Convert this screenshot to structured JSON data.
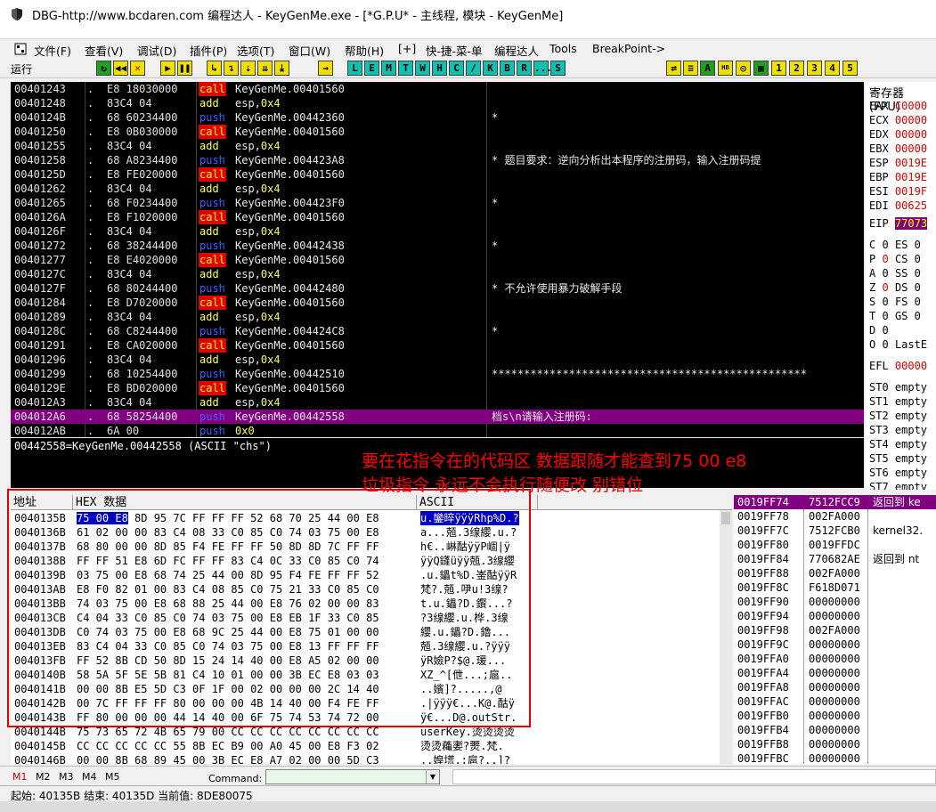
{
  "window": {
    "title": "DBG-http://www.bcdaren.com 编程达人 - KeyGenMe.exe - [*G.P.U* - 主线程, 模块 - KeyGenMe]"
  },
  "menu": [
    "文件(F)",
    "查看(V)",
    "调试(D)",
    "插件(P)",
    "选项(T)",
    "窗口(W)",
    "帮助(H)",
    "[+]",
    "快-捷-菜-单",
    "编程达人",
    "Tools",
    "BreakPoint->"
  ],
  "toolbar": {
    "status": "运行",
    "letters": [
      "L",
      "E",
      "M",
      "T",
      "W",
      "H",
      "C",
      "/",
      "K",
      "B",
      "R",
      "...",
      "S"
    ],
    "numbers": [
      "1",
      "2",
      "3",
      "4",
      "5"
    ]
  },
  "disasm": [
    {
      "addr": "00401243",
      "mark": ".",
      "hex": "E8 18030000",
      "mn": "call",
      "op": "KeyGenMe.00401560",
      "cm": ""
    },
    {
      "addr": "00401248",
      "mark": ".",
      "hex": "83C4 04",
      "mn": "add",
      "op": "esp,",
      "imm": "0x4",
      "cm": ""
    },
    {
      "addr": "0040124B",
      "mark": ".",
      "hex": "68 60234400",
      "mn": "push",
      "op": "KeyGenMe.00442360",
      "cm": "*"
    },
    {
      "addr": "00401250",
      "mark": ".",
      "hex": "E8 0B030000",
      "mn": "call",
      "op": "KeyGenMe.00401560",
      "cm": ""
    },
    {
      "addr": "00401255",
      "mark": ".",
      "hex": "83C4 04",
      "mn": "add",
      "op": "esp,",
      "imm": "0x4",
      "cm": ""
    },
    {
      "addr": "00401258",
      "mark": ".",
      "hex": "68 A8234400",
      "mn": "push",
      "op": "KeyGenMe.004423A8",
      "cm": "*  题目要求：逆向分析出本程序的注册码，输入注册码提"
    },
    {
      "addr": "0040125D",
      "mark": ".",
      "hex": "E8 FE020000",
      "mn": "call",
      "op": "KeyGenMe.00401560",
      "cm": ""
    },
    {
      "addr": "00401262",
      "mark": ".",
      "hex": "83C4 04",
      "mn": "add",
      "op": "esp,",
      "imm": "0x4",
      "cm": ""
    },
    {
      "addr": "00401265",
      "mark": ".",
      "hex": "68 F0234400",
      "mn": "push",
      "op": "KeyGenMe.004423F0",
      "cm": "*"
    },
    {
      "addr": "0040126A",
      "mark": ".",
      "hex": "E8 F1020000",
      "mn": "call",
      "op": "KeyGenMe.00401560",
      "cm": ""
    },
    {
      "addr": "0040126F",
      "mark": ".",
      "hex": "83C4 04",
      "mn": "add",
      "op": "esp,",
      "imm": "0x4",
      "cm": ""
    },
    {
      "addr": "00401272",
      "mark": ".",
      "hex": "68 38244400",
      "mn": "push",
      "op": "KeyGenMe.00442438",
      "cm": "*"
    },
    {
      "addr": "00401277",
      "mark": ".",
      "hex": "E8 E4020000",
      "mn": "call",
      "op": "KeyGenMe.00401560",
      "cm": ""
    },
    {
      "addr": "0040127C",
      "mark": ".",
      "hex": "83C4 04",
      "mn": "add",
      "op": "esp,",
      "imm": "0x4",
      "cm": ""
    },
    {
      "addr": "0040127F",
      "mark": ".",
      "hex": "68 80244400",
      "mn": "push",
      "op": "KeyGenMe.00442480",
      "cm": "*                   不允许使用暴力破解手段"
    },
    {
      "addr": "00401284",
      "mark": ".",
      "hex": "E8 D7020000",
      "mn": "call",
      "op": "KeyGenMe.00401560",
      "cm": ""
    },
    {
      "addr": "00401289",
      "mark": ".",
      "hex": "83C4 04",
      "mn": "add",
      "op": "esp,",
      "imm": "0x4",
      "cm": ""
    },
    {
      "addr": "0040128C",
      "mark": ".",
      "hex": "68 C8244400",
      "mn": "push",
      "op": "KeyGenMe.004424C8",
      "cm": "*"
    },
    {
      "addr": "00401291",
      "mark": ".",
      "hex": "E8 CA020000",
      "mn": "call",
      "op": "KeyGenMe.00401560",
      "cm": ""
    },
    {
      "addr": "00401296",
      "mark": ".",
      "hex": "83C4 04",
      "mn": "add",
      "op": "esp,",
      "imm": "0x4",
      "cm": ""
    },
    {
      "addr": "00401299",
      "mark": ".",
      "hex": "68 10254400",
      "mn": "push",
      "op": "KeyGenMe.00442510",
      "cm": "*************************************************"
    },
    {
      "addr": "0040129E",
      "mark": ".",
      "hex": "E8 BD020000",
      "mn": "call",
      "op": "KeyGenMe.00401560",
      "cm": ""
    },
    {
      "addr": "004012A3",
      "mark": ".",
      "hex": "83C4 04",
      "mn": "add",
      "op": "esp,",
      "imm": "0x4",
      "cm": ""
    },
    {
      "addr": "004012A6",
      "mark": ".",
      "hex": "68 58254400",
      "mn": "push",
      "op": "KeyGenMe.00442558",
      "cm": "档s\\n请输入注册码:",
      "sel": true
    },
    {
      "addr": "004012AB",
      "mark": ".",
      "hex": "6A 00",
      "mn": "push",
      "op": "",
      "imm": "0x0",
      "cm": ""
    }
  ],
  "info_line": "00442558=KeyGenMe.00442558 (ASCII \"chs\")",
  "annotation": {
    "line1": "要在花指令在的代码区 数据跟随才能查到75 00 e8",
    "line2": "垃圾指令 永远不会执行随便改  别错位"
  },
  "registers": {
    "title": "寄存器 (FPU)",
    "gp": [
      {
        "n": "EAX",
        "v": "C0000"
      },
      {
        "n": "ECX",
        "v": "00000"
      },
      {
        "n": "EDX",
        "v": "00000"
      },
      {
        "n": "EBX",
        "v": "00000"
      },
      {
        "n": "ESP",
        "v": "0019E"
      },
      {
        "n": "EBP",
        "v": "0019E"
      },
      {
        "n": "ESI",
        "v": "0019F"
      },
      {
        "n": "EDI",
        "v": "00625"
      }
    ],
    "eip": {
      "n": "EIP",
      "v": "77073"
    },
    "flags": [
      {
        "f": "C",
        "b": "0",
        "s": "ES 0"
      },
      {
        "f": "P",
        "b": "0",
        "s": "CS 0"
      },
      {
        "f": "A",
        "b": "0",
        "s": "SS 0"
      },
      {
        "f": "Z",
        "b": "0",
        "s": "DS 0"
      },
      {
        "f": "S",
        "b": "0",
        "s": "FS 0"
      },
      {
        "f": "T",
        "b": "0",
        "s": "GS 0"
      },
      {
        "f": "D",
        "b": "0",
        "s": ""
      },
      {
        "f": "O",
        "b": "0",
        "s": "LastE"
      }
    ],
    "efl": {
      "n": "EFL",
      "v": "00000"
    },
    "st": [
      "ST0 empty",
      "ST1 empty",
      "ST2 empty",
      "ST3 empty",
      "ST4 empty",
      "ST5 empty",
      "ST6 empty",
      "ST7 empty"
    ]
  },
  "dump": {
    "headers": {
      "addr": "地址",
      "hex": "HEX 数据",
      "ascii": "ASCII"
    },
    "rows": [
      {
        "addr": "0040135B",
        "sel": "75 00 E8",
        "hex": " 8D 95 7C FF FF FF 52 68 70 25 44 00 E8",
        "asc": "u.鑾晬ÿÿÿRhp%D.?"
      },
      {
        "addr": "0040136B",
        "hex": "61 02 00 00 83 C4 08 33 C0 85 C0 74 03 75 00 E8",
        "asc": "a...兡.3缐纓.u.?"
      },
      {
        "addr": "0040137B",
        "hex": "68 80 00 00 8D 85 F4 FE FF FF 50 8D 8D 7C FF FF",
        "asc": "h€..崊酤ÿÿP崓|ÿ"
      },
      {
        "addr": "0040138B",
        "hex": "FF FF 51 E8 6D FC FF FF 83 C4 0C 33 C0 85 C0 74",
        "asc": "ÿÿQ鑝üÿÿ兡.3缐纓"
      },
      {
        "addr": "0040139B",
        "hex": "03 75 00 E8 68 74 25 44 00 8D 95 F4 FE FF FF 52",
        "asc": ".u.鑘t%D.崟酤ÿÿR"
      },
      {
        "addr": "004013AB",
        "hex": "E8 F0 82 01 00 83 C4 08 85 C0 75 21 33 C0 85 C0",
        "asc": "梵?.兡.吚u!3缐?"
      },
      {
        "addr": "004013BB",
        "hex": "74 03 75 00 E8 68 88 25 44 00 E8 76 02 00 00 83",
        "asc": "t.u.鑘?D.鑦...?"
      },
      {
        "addr": "004013CB",
        "hex": "C4 04 33 C0 85 C0 74 03 75 00 E8 EB 1F 33 C0 85",
        "asc": "?3缐纓.u.桦.3缐"
      },
      {
        "addr": "004013DB",
        "hex": "C0 74 03 75 00 E8 68 9C 25 44 00 E8 75 01 00 00",
        "asc": "纓.u.鑘?D.鑥..."
      },
      {
        "addr": "004013EB",
        "hex": "83 C4 04 33 C0 85 C0 74 03 75 00 E8 13 FF FF FF",
        "asc": "兡.3缐纓.u.?ÿÿÿ"
      },
      {
        "addr": "004013FB",
        "hex": "FF 52 8B CD 50 8D 15 24 14 40 00 E8 A5 02 00 00",
        "asc": "ÿR嬐P?$@.瑗..."
      },
      {
        "addr": "0040140B",
        "hex": "58 5A 5F 5E 5B 81 C4 10 01 00 00 3B EC E8 03 03",
        "asc": "XZ_^[伳...;扈.."
      },
      {
        "addr": "0040141B",
        "hex": "00 00 8B E5 5D C3 0F 1F 00 02 00 00 00 2C 14 40",
        "asc": "..嬪]?.....,@"
      },
      {
        "addr": "0040142B",
        "hex": "00 7C FF FF FF 80 00 00 00 4B 14 40 00 F4 FE FF",
        "asc": ".|ÿÿÿ€...K@.酤ÿ"
      },
      {
        "addr": "0040143B",
        "hex": "FF 80 00 00 00 44 14 40 00 6F 75 74 53 74 72 00",
        "asc": "ÿ€...D@.outStr."
      },
      {
        "addr": "0040144B",
        "hex": "75 73 65 72 4B 65 79 00 CC CC CC CC CC CC CC CC",
        "asc": "userKey.烫烫烫烫"
      },
      {
        "addr": "0040145B",
        "hex": "CC CC CC CC CC 55 8B EC B9 00 A0 45 00 E8 F3 02",
        "asc": "烫烫蘒嬱?燛.梵."
      },
      {
        "addr": "0040146B",
        "hex": "00 00 8B 68 89 45 00 3B EC E8 A7 02 00 00 5D C3",
        "asc": "..媓塃.;扈?..]?"
      }
    ]
  },
  "stack": [
    {
      "a": "0019FF74",
      "v": "7512FCC9",
      "c": "返回到 ke",
      "sel": true
    },
    {
      "a": "0019FF78",
      "v": "002FA000",
      "c": ""
    },
    {
      "a": "0019FF7C",
      "v": "7512FCB0",
      "c": "kernel32."
    },
    {
      "a": "0019FF80",
      "v": "0019FFDC",
      "c": ""
    },
    {
      "a": "0019FF84",
      "v": "770682AE",
      "c": "返回到 nt"
    },
    {
      "a": "0019FF88",
      "v": "002FA000",
      "c": ""
    },
    {
      "a": "0019FF8C",
      "v": "F618D071",
      "c": ""
    },
    {
      "a": "0019FF90",
      "v": "00000000",
      "c": ""
    },
    {
      "a": "0019FF94",
      "v": "00000000",
      "c": ""
    },
    {
      "a": "0019FF98",
      "v": "002FA000",
      "c": ""
    },
    {
      "a": "0019FF9C",
      "v": "00000000",
      "c": ""
    },
    {
      "a": "0019FFA0",
      "v": "00000000",
      "c": ""
    },
    {
      "a": "0019FFA4",
      "v": "00000000",
      "c": ""
    },
    {
      "a": "0019FFA8",
      "v": "00000000",
      "c": ""
    },
    {
      "a": "0019FFAC",
      "v": "00000000",
      "c": ""
    },
    {
      "a": "0019FFB0",
      "v": "00000000",
      "c": ""
    },
    {
      "a": "0019FFB4",
      "v": "00000000",
      "c": ""
    },
    {
      "a": "0019FFB8",
      "v": "00000000",
      "c": ""
    },
    {
      "a": "0019FFBC",
      "v": "00000000",
      "c": ""
    }
  ],
  "cmdbar": {
    "tabs": [
      "M1",
      "M2",
      "M3",
      "M4",
      "M5"
    ],
    "label": "Command:"
  },
  "status": "起始: 40135B 结束: 40135D 当前值: 8DE80075"
}
